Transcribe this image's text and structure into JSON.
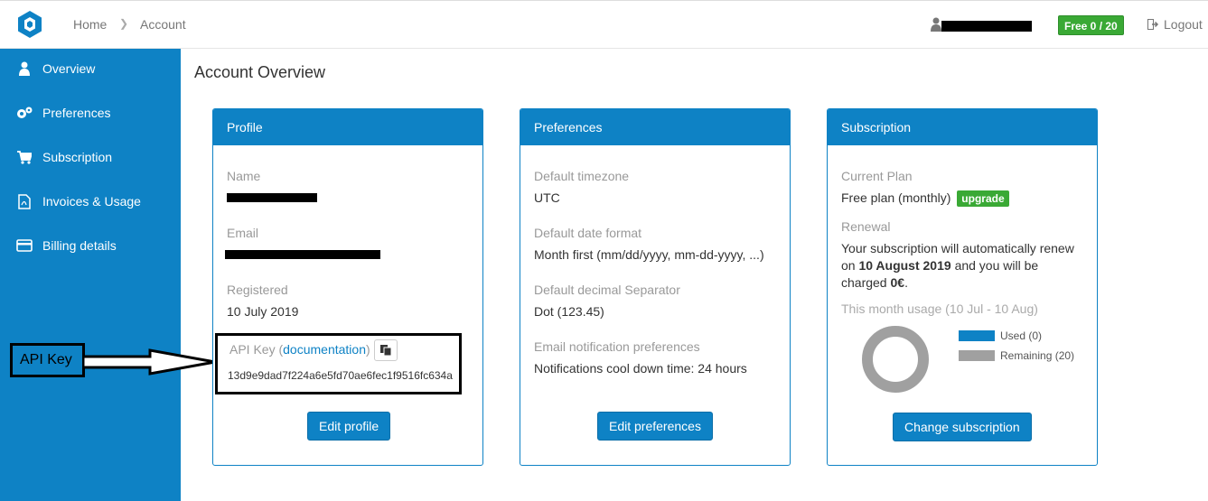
{
  "breadcrumb": {
    "home": "Home",
    "current": "Account"
  },
  "header": {
    "user_name": "",
    "plan_badge": "Free 0 / 20",
    "logout": "Logout"
  },
  "sidebar": {
    "items": [
      {
        "label": "Overview",
        "icon": "user-icon"
      },
      {
        "label": "Preferences",
        "icon": "gears-icon"
      },
      {
        "label": "Subscription",
        "icon": "cart-icon"
      },
      {
        "label": "Invoices & Usage",
        "icon": "pdf-icon"
      },
      {
        "label": "Billing details",
        "icon": "credit-card-icon"
      }
    ]
  },
  "annotation": {
    "label": "API Key"
  },
  "page_title": "Account Overview",
  "profile": {
    "title": "Profile",
    "name_label": "Name",
    "email_label": "Email",
    "registered_label": "Registered",
    "registered_value": "10 July 2019",
    "api_label": "API Key (",
    "api_doc_link": "documentation",
    "api_label_close": ")",
    "api_key": "13d9e9dad7f224a6e5fd70ae6fec1f9516fc634a",
    "button": "Edit profile"
  },
  "preferences": {
    "title": "Preferences",
    "timezone_label": "Default timezone",
    "timezone_value": "UTC",
    "date_label": "Default date format",
    "date_value": "Month first (mm/dd/yyyy, mm-dd-yyyy, ...)",
    "decimal_label": "Default decimal Separator",
    "decimal_value": "Dot (123.45)",
    "email_label": "Email notification preferences",
    "email_value": "Notifications cool down time: 24 hours",
    "button": "Edit preferences"
  },
  "subscription": {
    "title": "Subscription",
    "plan_label": "Current Plan",
    "plan_value": "Free plan (monthly)",
    "upgrade": "upgrade",
    "renewal_label": "Renewal",
    "renew_pre": "Your subscription will automatically renew on",
    "renew_date": "10 August 2019",
    "renew_mid": "and you will be charged",
    "renew_amount": "0€",
    "renew_end": ".",
    "usage_label": "This month usage (10 Jul - 10 Aug)",
    "legend_used": "Used (0)",
    "legend_remaining": "Remaining (20)",
    "used": 0,
    "remaining": 20,
    "button": "Change subscription"
  },
  "colors": {
    "primary": "#0e82c5",
    "success": "#3aa935",
    "remaining": "#a0a0a0"
  }
}
